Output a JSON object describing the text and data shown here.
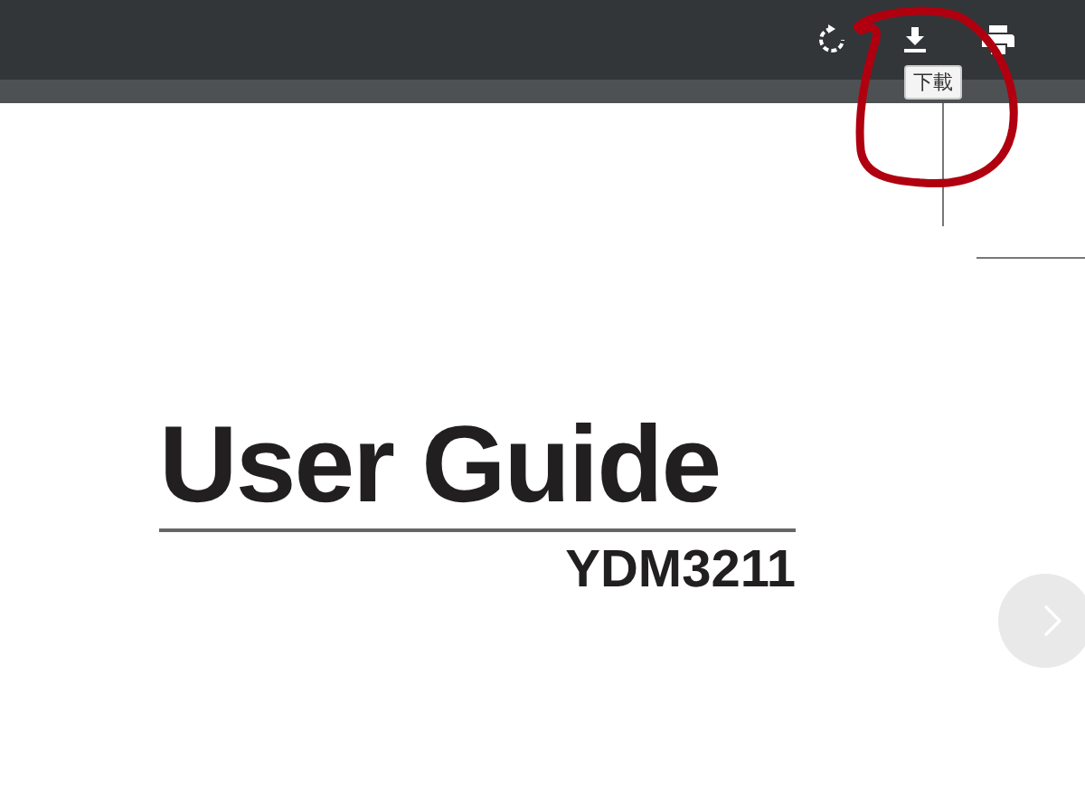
{
  "toolbar": {
    "tooltip": "下載"
  },
  "document": {
    "title": "User Guide",
    "model": "YDM3211"
  }
}
